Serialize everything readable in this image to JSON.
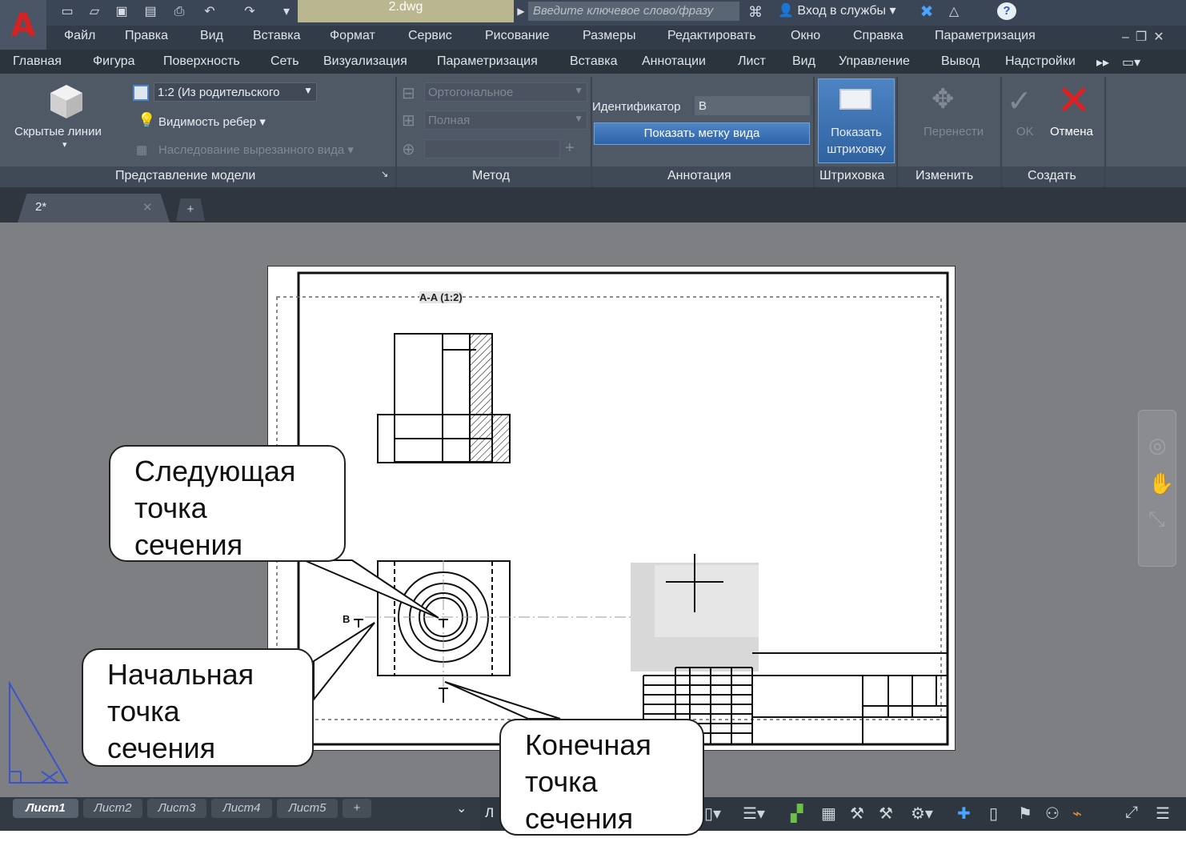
{
  "titlebar": {
    "doc_title": "2.dwg",
    "search_placeholder": "Введите ключевое слово/фразу",
    "login": "Вход в службы"
  },
  "menu": [
    "Файл",
    "Правка",
    "Вид",
    "Вставка",
    "Формат",
    "Сервис",
    "Рисование",
    "Размеры",
    "Редактировать",
    "Окно",
    "Справка",
    "Параметризация"
  ],
  "ribbon_tabs": [
    "Главная",
    "Фигура",
    "Поверхность",
    "Сеть",
    "Визуализация",
    "Параметризация",
    "Вставка",
    "Аннотации",
    "Лист",
    "Вид",
    "Управление",
    "Вывод",
    "Надстройки"
  ],
  "ribbon": {
    "hidden_lines": "Скрытые линии",
    "scale_combo": "1:2 (Из родительского",
    "edge_visibility": "Видимость ребер",
    "inherit_cut": "Наследование вырезанного вида",
    "projection_combo": "Ортогональное",
    "method_combo": "Полная",
    "identifier_label": "Идентификатор",
    "identifier_value": "B",
    "show_view_label": "Показать метку вида",
    "show_hatch": "Показать штриховку",
    "move": "Перенести",
    "ok": "OK",
    "cancel": "Отмена",
    "panels": [
      "Представление модели",
      "Метод",
      "Аннотация",
      "Штриховка",
      "Изменить",
      "Создать"
    ]
  },
  "doc_tab": "2*",
  "drawing": {
    "section_label": "A-A (1:2)",
    "cut_label": "B"
  },
  "layout_tabs": [
    "Лист1",
    "Лист2",
    "Лист3",
    "Лист4",
    "Лист5"
  ],
  "status_partial": "Л",
  "callouts": {
    "next_point": [
      "Следующая",
      "точка",
      "сечения"
    ],
    "start_point": [
      "Начальная",
      "точка",
      "сечения"
    ],
    "end_point": [
      "Конечная",
      "точка",
      "сечения"
    ]
  },
  "colors": {
    "accent_blue": "#3a72b8",
    "cancel_red": "#e02020",
    "app_red": "#d42323"
  }
}
